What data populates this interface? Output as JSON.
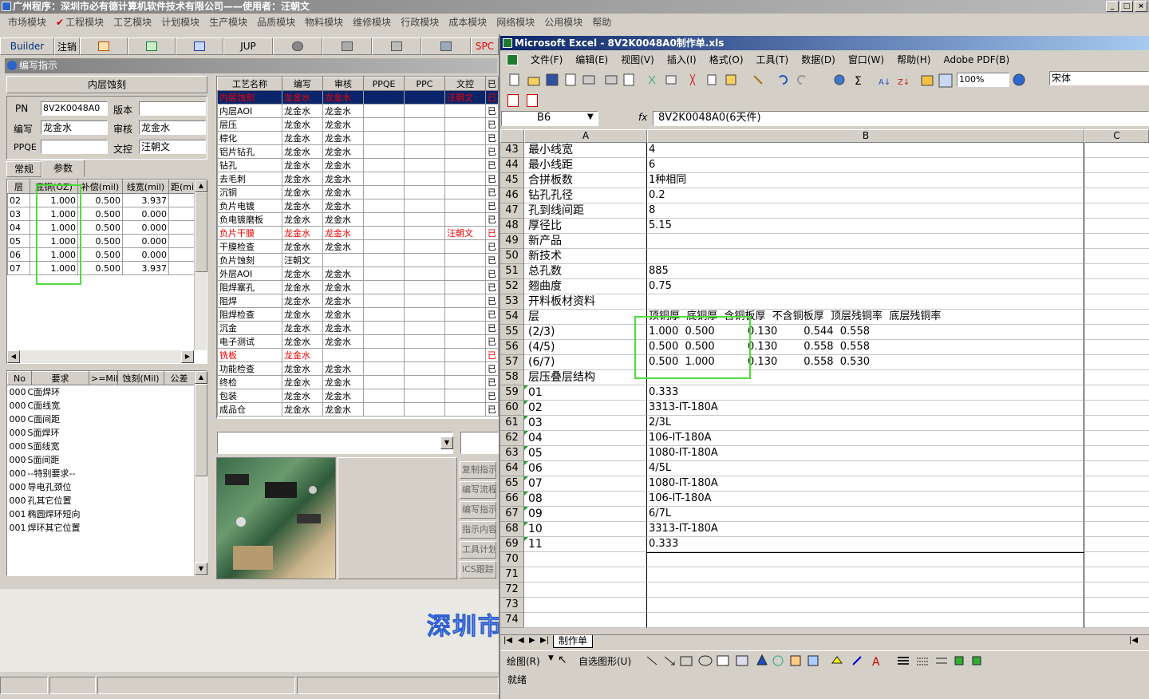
{
  "app": {
    "title": "广州程序：深圳市必有德计算机软件技术有限公司——使用者：汪朝文",
    "window_buttons": [
      "_",
      "□",
      "×"
    ],
    "menu": [
      {
        "label": "市场模块",
        "checked": false
      },
      {
        "label": "工程模块",
        "checked": true
      },
      {
        "label": "工艺模块",
        "checked": false
      },
      {
        "label": "计划模块",
        "checked": false
      },
      {
        "label": "生产模块",
        "checked": false
      },
      {
        "label": "品质模块",
        "checked": false
      },
      {
        "label": "物料模块",
        "checked": false
      },
      {
        "label": "维修模块",
        "checked": false
      },
      {
        "label": "行政模块",
        "checked": false
      },
      {
        "label": "成本模块",
        "checked": false
      },
      {
        "label": "网络模块",
        "checked": false
      },
      {
        "label": "公用模块",
        "checked": false
      },
      {
        "label": "帮助",
        "checked": false
      }
    ],
    "toolbar": {
      "builder": "Builder",
      "logout": "注销",
      "jup": "JUP",
      "spc": "SPC"
    },
    "watermark": "深圳市"
  },
  "panel": {
    "title": "编写指示",
    "process_name": "内层蚀刻",
    "fields": {
      "pn_label": "PN",
      "pn": "8V2K0048A0",
      "version_label": "版本",
      "version": "",
      "writer_label": "编写",
      "writer": "龙金水",
      "review_label": "审核",
      "review": "龙金水",
      "ppqe_label": "PPQE",
      "ppqe": "",
      "control_label": "文控",
      "control": "汪朝文"
    },
    "tabs": [
      "常规",
      "参数"
    ],
    "layer_table": {
      "headers": [
        "层",
        "底铜(OZ)",
        "补偿(mil)",
        "线宽(mil)",
        "距(mi"
      ],
      "rows": [
        [
          "02",
          "1.000",
          "0.500",
          "3.937"
        ],
        [
          "03",
          "1.000",
          "0.500",
          "0.000"
        ],
        [
          "04",
          "1.000",
          "0.500",
          "0.000"
        ],
        [
          "05",
          "1.000",
          "0.500",
          "0.000"
        ],
        [
          "06",
          "1.000",
          "0.500",
          "0.000"
        ],
        [
          "07",
          "1.000",
          "0.500",
          "3.937"
        ]
      ]
    },
    "req_table": {
      "headers": [
        "No",
        "要求",
        ">=Mil",
        "蚀刻(Mil)",
        "公差"
      ],
      "rows": [
        [
          "000",
          "C面焊环"
        ],
        [
          "000",
          "C面线宽"
        ],
        [
          "000",
          "C面间距"
        ],
        [
          "000",
          "S面焊环"
        ],
        [
          "000",
          "S面线宽"
        ],
        [
          "000",
          "S面间距"
        ],
        [
          "000",
          "--特别要求--"
        ],
        [
          "000",
          "导电孔颈位"
        ],
        [
          "000",
          "孔其它位置"
        ],
        [
          "001",
          "椭圆焊环短向"
        ],
        [
          "001",
          "焊环其它位置"
        ]
      ]
    },
    "process_table": {
      "headers": [
        "工艺名称",
        "编写",
        "审核",
        "PPQE",
        "PPC",
        "文控",
        "已"
      ],
      "rows": [
        {
          "name": "内层蚀刻",
          "w": "龙金水",
          "r": "龙金水",
          "c": "汪朝文",
          "state": "sel"
        },
        {
          "name": "内层AOI",
          "w": "龙金水",
          "r": "龙金水",
          "c": "",
          "state": ""
        },
        {
          "name": "层压",
          "w": "龙金水",
          "r": "龙金水",
          "c": "",
          "state": ""
        },
        {
          "name": "棕化",
          "w": "龙金水",
          "r": "龙金水",
          "c": "",
          "state": ""
        },
        {
          "name": "铝片钻孔",
          "w": "龙金水",
          "r": "龙金水",
          "c": "",
          "state": ""
        },
        {
          "name": "钻孔",
          "w": "龙金水",
          "r": "龙金水",
          "c": "",
          "state": ""
        },
        {
          "name": "去毛刺",
          "w": "龙金水",
          "r": "龙金水",
          "c": "",
          "state": ""
        },
        {
          "name": "沉铜",
          "w": "龙金水",
          "r": "龙金水",
          "c": "",
          "state": ""
        },
        {
          "name": "负片电镀",
          "w": "龙金水",
          "r": "龙金水",
          "c": "",
          "state": ""
        },
        {
          "name": "负电镀磨板",
          "w": "龙金水",
          "r": "龙金水",
          "c": "",
          "state": ""
        },
        {
          "name": "负片干膜",
          "w": "龙金水",
          "r": "龙金水",
          "c": "汪朝文",
          "state": "red"
        },
        {
          "name": "干膜检查",
          "w": "龙金水",
          "r": "龙金水",
          "c": "",
          "state": ""
        },
        {
          "name": "负片蚀刻",
          "w": "汪朝文",
          "r": "",
          "c": "",
          "state": ""
        },
        {
          "name": "外层AOI",
          "w": "龙金水",
          "r": "龙金水",
          "c": "",
          "state": ""
        },
        {
          "name": "阻焊塞孔",
          "w": "龙金水",
          "r": "龙金水",
          "c": "",
          "state": ""
        },
        {
          "name": "阻焊",
          "w": "龙金水",
          "r": "龙金水",
          "c": "",
          "state": ""
        },
        {
          "name": "阻焊检查",
          "w": "龙金水",
          "r": "龙金水",
          "c": "",
          "state": ""
        },
        {
          "name": "沉金",
          "w": "龙金水",
          "r": "龙金水",
          "c": "",
          "state": ""
        },
        {
          "name": "电子测试",
          "w": "龙金水",
          "r": "龙金水",
          "c": "",
          "state": ""
        },
        {
          "name": "铣板",
          "w": "龙金水",
          "r": "",
          "c": "",
          "state": "red"
        },
        {
          "name": "功能检查",
          "w": "龙金水",
          "r": "龙金水",
          "c": "",
          "state": ""
        },
        {
          "name": "终检",
          "w": "龙金水",
          "r": "龙金水",
          "c": "",
          "state": ""
        },
        {
          "name": "包装",
          "w": "龙金水",
          "r": "龙金水",
          "c": "",
          "state": ""
        },
        {
          "name": "成品仓",
          "w": "龙金水",
          "r": "龙金水",
          "c": "",
          "state": ""
        }
      ]
    },
    "side_buttons": [
      "复制指示",
      "编写流程",
      "编写指示",
      "指示内容",
      "工具计划",
      "ICS跟踪"
    ]
  },
  "excel": {
    "title": "Microsoft Excel - 8V2K0048A0制作单.xls",
    "menu": [
      "文件(F)",
      "编辑(E)",
      "视图(V)",
      "插入(I)",
      "格式(O)",
      "工具(T)",
      "数据(D)",
      "窗口(W)",
      "帮助(H)",
      "Adobe PDF(B)"
    ],
    "zoom": "100%",
    "font": "宋体",
    "name_box": "B6",
    "fx": "fx",
    "formula": "8V2K0048A0(6天件)",
    "columns": [
      "A",
      "B",
      "C"
    ],
    "sheet_tab": "制作单",
    "drawing_label": "绘图(R)",
    "autoshape_label": "自选图形(U)",
    "status": "就绪"
  },
  "chart_data": {
    "type": "table",
    "rows": [
      {
        "n": "43",
        "a": "最小线宽",
        "b": "4"
      },
      {
        "n": "44",
        "a": "最小线距",
        "b": "6"
      },
      {
        "n": "45",
        "a": "合拼板数",
        "b": "1种相同"
      },
      {
        "n": "46",
        "a": "钻孔孔径",
        "b": "0.2"
      },
      {
        "n": "47",
        "a": "孔到线间距",
        "b": "8"
      },
      {
        "n": "48",
        "a": "厚径比",
        "b": "5.15"
      },
      {
        "n": "49",
        "a": "新产品",
        "b": ""
      },
      {
        "n": "50",
        "a": "新技术",
        "b": ""
      },
      {
        "n": "51",
        "a": "总孔数",
        "b": "885"
      },
      {
        "n": "52",
        "a": "翘曲度",
        "b": "0.75"
      },
      {
        "n": "53",
        "a": "开料板材资料",
        "b": ""
      },
      {
        "n": "54",
        "a": "层",
        "b": "顶铜厚  底铜厚  含铜板厚  不含铜板厚  顶层残铜率  底层残铜率"
      },
      {
        "n": "55",
        "a": "(2/3)",
        "b": "1.000  0.500          0.130        0.544  0.558"
      },
      {
        "n": "56",
        "a": "(4/5)",
        "b": "0.500  0.500          0.130        0.558  0.558"
      },
      {
        "n": "57",
        "a": "(6/7)",
        "b": "0.500  1.000          0.130        0.558  0.530"
      },
      {
        "n": "58",
        "a": "层压叠层结构",
        "b": ""
      },
      {
        "n": "59",
        "a": "01",
        "b": "0.333"
      },
      {
        "n": "60",
        "a": "02",
        "b": "3313-IT-180A"
      },
      {
        "n": "61",
        "a": "03",
        "b": "2/3L"
      },
      {
        "n": "62",
        "a": "04",
        "b": "106-IT-180A"
      },
      {
        "n": "63",
        "a": "05",
        "b": "1080-IT-180A"
      },
      {
        "n": "64",
        "a": "06",
        "b": "4/5L"
      },
      {
        "n": "65",
        "a": "07",
        "b": "1080-IT-180A"
      },
      {
        "n": "66",
        "a": "08",
        "b": "106-IT-180A"
      },
      {
        "n": "67",
        "a": "09",
        "b": "6/7L"
      },
      {
        "n": "68",
        "a": "10",
        "b": "3313-IT-180A"
      },
      {
        "n": "69",
        "a": "11",
        "b": "0.333"
      },
      {
        "n": "70",
        "a": "",
        "b": ""
      },
      {
        "n": "71",
        "a": "",
        "b": ""
      },
      {
        "n": "72",
        "a": "",
        "b": ""
      },
      {
        "n": "73",
        "a": "",
        "b": ""
      },
      {
        "n": "74",
        "a": "",
        "b": ""
      }
    ]
  }
}
